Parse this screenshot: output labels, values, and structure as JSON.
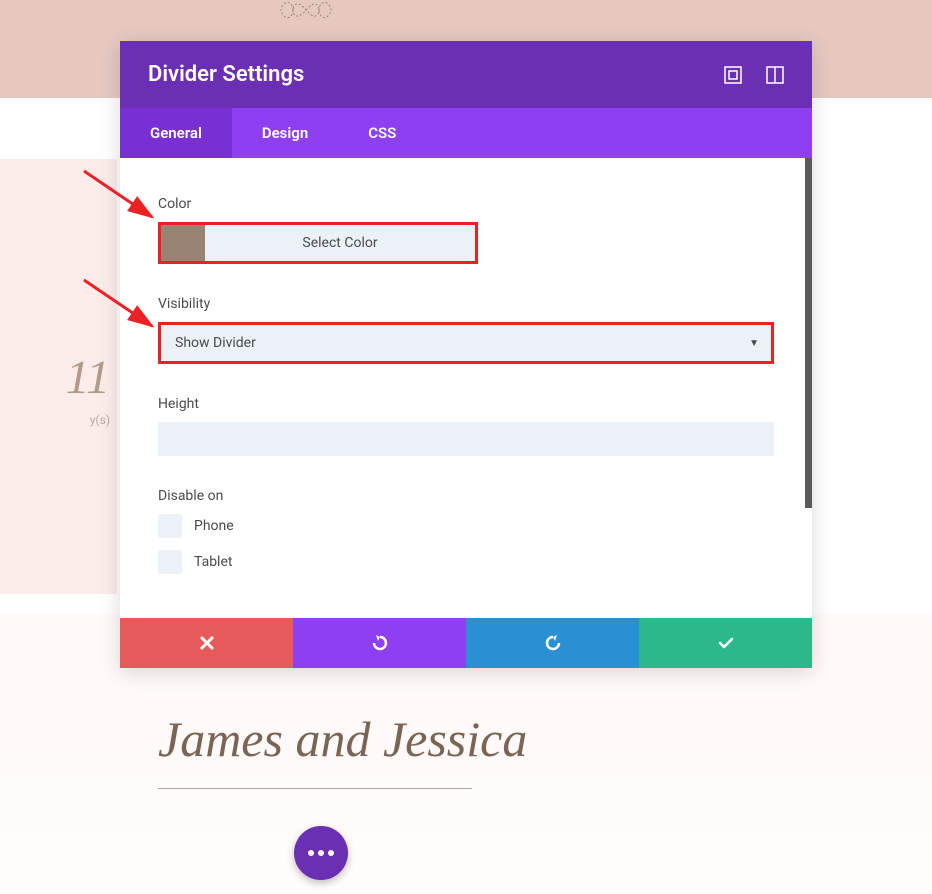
{
  "background": {
    "countdown_number": "11",
    "countdown_unit": "y(s)",
    "countdown_separator": ":",
    "script_name": "James and Jessica"
  },
  "modal": {
    "title": "Divider Settings",
    "tabs": {
      "general": "General",
      "design": "Design",
      "css": "CSS"
    },
    "fields": {
      "color_label": "Color",
      "color_button": "Select Color",
      "color_value": "#9A8372",
      "visibility_label": "Visibility",
      "visibility_value": "Show Divider",
      "height_label": "Height",
      "height_value": "",
      "disable_label": "Disable on",
      "disable_options": {
        "phone": "Phone",
        "tablet": "Tablet"
      }
    }
  }
}
